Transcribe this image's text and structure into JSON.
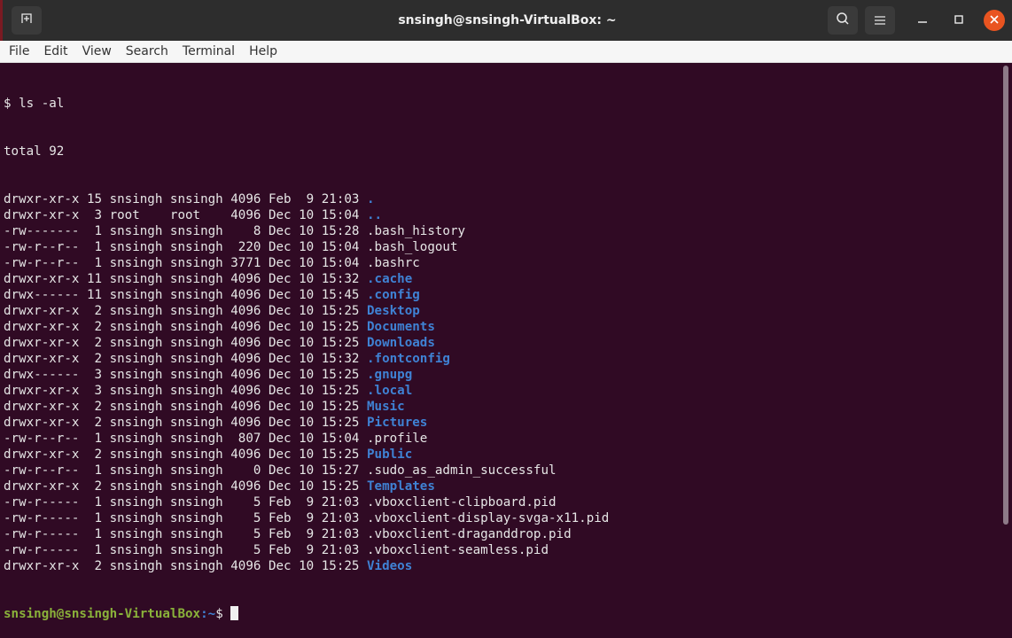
{
  "window": {
    "title": "snsingh@snsingh-VirtualBox: ~",
    "new_tab_icon": "new-tab-icon",
    "search_icon": "search-icon",
    "menu_icon": "hamburger-menu-icon",
    "minimize_icon": "minimize-icon",
    "maximize_icon": "maximize-icon",
    "close_icon": "close-icon",
    "close_color": "#e95420"
  },
  "menu": [
    "File",
    "Edit",
    "View",
    "Search",
    "Terminal",
    "Help"
  ],
  "terminal": {
    "command": "$ ls -al",
    "total": "total 92",
    "entries": [
      {
        "meta": "drwxr-xr-x 15 snsingh snsingh 4096 Feb  9 21:03 ",
        "name": ".",
        "dir": true
      },
      {
        "meta": "drwxr-xr-x  3 root    root    4096 Dec 10 15:04 ",
        "name": "..",
        "dir": true
      },
      {
        "meta": "-rw-------  1 snsingh snsingh    8 Dec 10 15:28 ",
        "name": ".bash_history",
        "dir": false
      },
      {
        "meta": "-rw-r--r--  1 snsingh snsingh  220 Dec 10 15:04 ",
        "name": ".bash_logout",
        "dir": false
      },
      {
        "meta": "-rw-r--r--  1 snsingh snsingh 3771 Dec 10 15:04 ",
        "name": ".bashrc",
        "dir": false
      },
      {
        "meta": "drwxr-xr-x 11 snsingh snsingh 4096 Dec 10 15:32 ",
        "name": ".cache",
        "dir": true
      },
      {
        "meta": "drwx------ 11 snsingh snsingh 4096 Dec 10 15:45 ",
        "name": ".config",
        "dir": true
      },
      {
        "meta": "drwxr-xr-x  2 snsingh snsingh 4096 Dec 10 15:25 ",
        "name": "Desktop",
        "dir": true
      },
      {
        "meta": "drwxr-xr-x  2 snsingh snsingh 4096 Dec 10 15:25 ",
        "name": "Documents",
        "dir": true
      },
      {
        "meta": "drwxr-xr-x  2 snsingh snsingh 4096 Dec 10 15:25 ",
        "name": "Downloads",
        "dir": true
      },
      {
        "meta": "drwxr-xr-x  2 snsingh snsingh 4096 Dec 10 15:32 ",
        "name": ".fontconfig",
        "dir": true
      },
      {
        "meta": "drwx------  3 snsingh snsingh 4096 Dec 10 15:25 ",
        "name": ".gnupg",
        "dir": true
      },
      {
        "meta": "drwxr-xr-x  3 snsingh snsingh 4096 Dec 10 15:25 ",
        "name": ".local",
        "dir": true
      },
      {
        "meta": "drwxr-xr-x  2 snsingh snsingh 4096 Dec 10 15:25 ",
        "name": "Music",
        "dir": true
      },
      {
        "meta": "drwxr-xr-x  2 snsingh snsingh 4096 Dec 10 15:25 ",
        "name": "Pictures",
        "dir": true
      },
      {
        "meta": "-rw-r--r--  1 snsingh snsingh  807 Dec 10 15:04 ",
        "name": ".profile",
        "dir": false
      },
      {
        "meta": "drwxr-xr-x  2 snsingh snsingh 4096 Dec 10 15:25 ",
        "name": "Public",
        "dir": true
      },
      {
        "meta": "-rw-r--r--  1 snsingh snsingh    0 Dec 10 15:27 ",
        "name": ".sudo_as_admin_successful",
        "dir": false
      },
      {
        "meta": "drwxr-xr-x  2 snsingh snsingh 4096 Dec 10 15:25 ",
        "name": "Templates",
        "dir": true
      },
      {
        "meta": "-rw-r-----  1 snsingh snsingh    5 Feb  9 21:03 ",
        "name": ".vboxclient-clipboard.pid",
        "dir": false
      },
      {
        "meta": "-rw-r-----  1 snsingh snsingh    5 Feb  9 21:03 ",
        "name": ".vboxclient-display-svga-x11.pid",
        "dir": false
      },
      {
        "meta": "-rw-r-----  1 snsingh snsingh    5 Feb  9 21:03 ",
        "name": ".vboxclient-draganddrop.pid",
        "dir": false
      },
      {
        "meta": "-rw-r-----  1 snsingh snsingh    5 Feb  9 21:03 ",
        "name": ".vboxclient-seamless.pid",
        "dir": false
      },
      {
        "meta": "drwxr-xr-x  2 snsingh snsingh 4096 Dec 10 15:25 ",
        "name": "Videos",
        "dir": true
      }
    ],
    "prompt_user": "snsingh@snsingh-VirtualBox",
    "prompt_path": ":~",
    "prompt_symbol": "$",
    "colors": {
      "background": "#300a24",
      "directory": "#3f82d4",
      "prompt_user": "#8ab23a",
      "text": "#e6e6e6"
    }
  }
}
